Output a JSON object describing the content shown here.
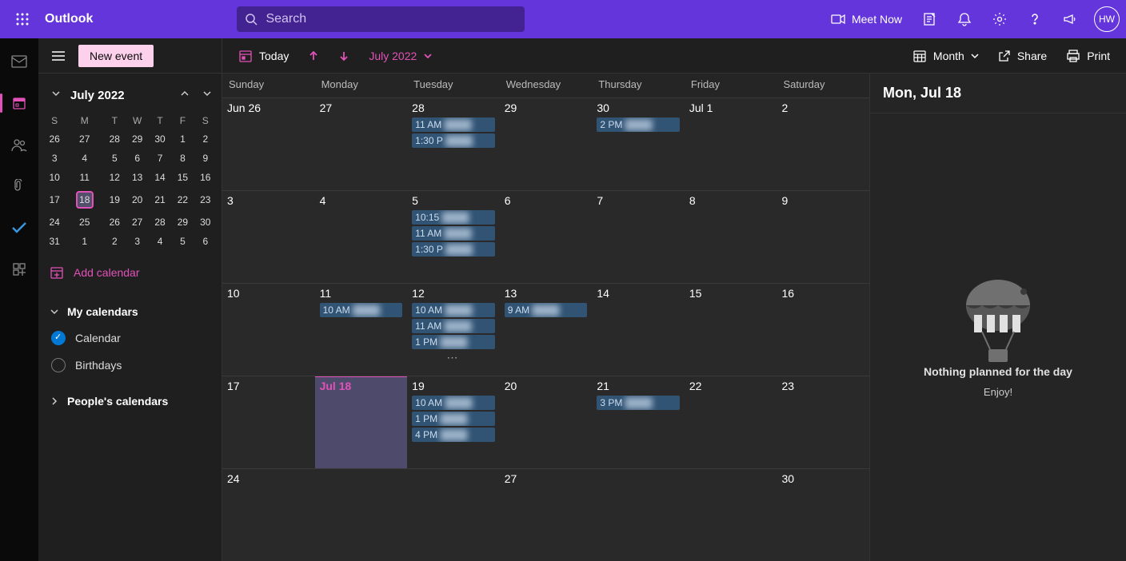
{
  "topbar": {
    "brand": "Outlook",
    "search_placeholder": "Search",
    "meet_now": "Meet Now",
    "avatar_initials": "HW"
  },
  "leftpane": {
    "new_event": "New event",
    "mini_title": "July 2022",
    "dow": [
      "S",
      "M",
      "T",
      "W",
      "T",
      "F",
      "S"
    ],
    "mini_weeks": [
      [
        "26",
        "27",
        "28",
        "29",
        "30",
        "1",
        "2"
      ],
      [
        "3",
        "4",
        "5",
        "6",
        "7",
        "8",
        "9"
      ],
      [
        "10",
        "11",
        "12",
        "13",
        "14",
        "15",
        "16"
      ],
      [
        "17",
        "18",
        "19",
        "20",
        "21",
        "22",
        "23"
      ],
      [
        "24",
        "25",
        "26",
        "27",
        "28",
        "29",
        "30"
      ],
      [
        "31",
        "1",
        "2",
        "3",
        "4",
        "5",
        "6"
      ]
    ],
    "today_day": "18",
    "add_calendar": "Add calendar",
    "my_calendars": "My calendars",
    "calendar": "Calendar",
    "birthdays": "Birthdays",
    "peoples_calendars": "People's calendars"
  },
  "cmdbar": {
    "today": "Today",
    "month_label": "July 2022",
    "view": "Month",
    "share": "Share",
    "print": "Print"
  },
  "grid": {
    "day_headers": [
      "Sunday",
      "Monday",
      "Tuesday",
      "Wednesday",
      "Thursday",
      "Friday",
      "Saturday"
    ],
    "weeks": [
      {
        "days": [
          {
            "label": "Jun 26",
            "events": []
          },
          {
            "label": "27",
            "events": []
          },
          {
            "label": "28",
            "events": [
              {
                "time": "11 AM"
              },
              {
                "time": "1:30 P"
              }
            ]
          },
          {
            "label": "29",
            "events": []
          },
          {
            "label": "30",
            "events": [
              {
                "time": "2 PM"
              }
            ]
          },
          {
            "label": "Jul 1",
            "events": []
          },
          {
            "label": "2",
            "events": []
          }
        ]
      },
      {
        "days": [
          {
            "label": "3",
            "events": []
          },
          {
            "label": "4",
            "events": []
          },
          {
            "label": "5",
            "events": [
              {
                "time": "10:15"
              },
              {
                "time": "11 AM"
              },
              {
                "time": "1:30 P"
              }
            ]
          },
          {
            "label": "6",
            "events": []
          },
          {
            "label": "7",
            "events": []
          },
          {
            "label": "8",
            "events": []
          },
          {
            "label": "9",
            "events": []
          }
        ]
      },
      {
        "days": [
          {
            "label": "10",
            "events": []
          },
          {
            "label": "11",
            "events": [
              {
                "time": "10 AM"
              }
            ]
          },
          {
            "label": "12",
            "events": [
              {
                "time": "10 AM"
              },
              {
                "time": "11 AM"
              },
              {
                "time": "1 PM"
              }
            ],
            "more": true
          },
          {
            "label": "13",
            "events": [
              {
                "time": "9 AM"
              }
            ]
          },
          {
            "label": "14",
            "events": []
          },
          {
            "label": "15",
            "events": []
          },
          {
            "label": "16",
            "events": []
          }
        ]
      },
      {
        "days": [
          {
            "label": "17",
            "events": []
          },
          {
            "label": "Jul 18",
            "events": [],
            "today": true
          },
          {
            "label": "19",
            "events": [
              {
                "time": "10 AM"
              },
              {
                "time": "1 PM"
              },
              {
                "time": "4 PM"
              }
            ]
          },
          {
            "label": "20",
            "events": []
          },
          {
            "label": "21",
            "events": [
              {
                "time": "3 PM"
              }
            ]
          },
          {
            "label": "22",
            "events": []
          },
          {
            "label": "23",
            "events": []
          }
        ]
      },
      {
        "days": [
          {
            "label": "24",
            "events": []
          },
          {
            "label": "",
            "events": []
          },
          {
            "label": "",
            "events": []
          },
          {
            "label": "27",
            "events": []
          },
          {
            "label": "",
            "events": []
          },
          {
            "label": "",
            "events": []
          },
          {
            "label": "30",
            "events": []
          }
        ]
      }
    ]
  },
  "rightpane": {
    "title": "Mon, Jul 18",
    "empty_title": "Nothing planned for the day",
    "empty_sub": "Enjoy!"
  }
}
